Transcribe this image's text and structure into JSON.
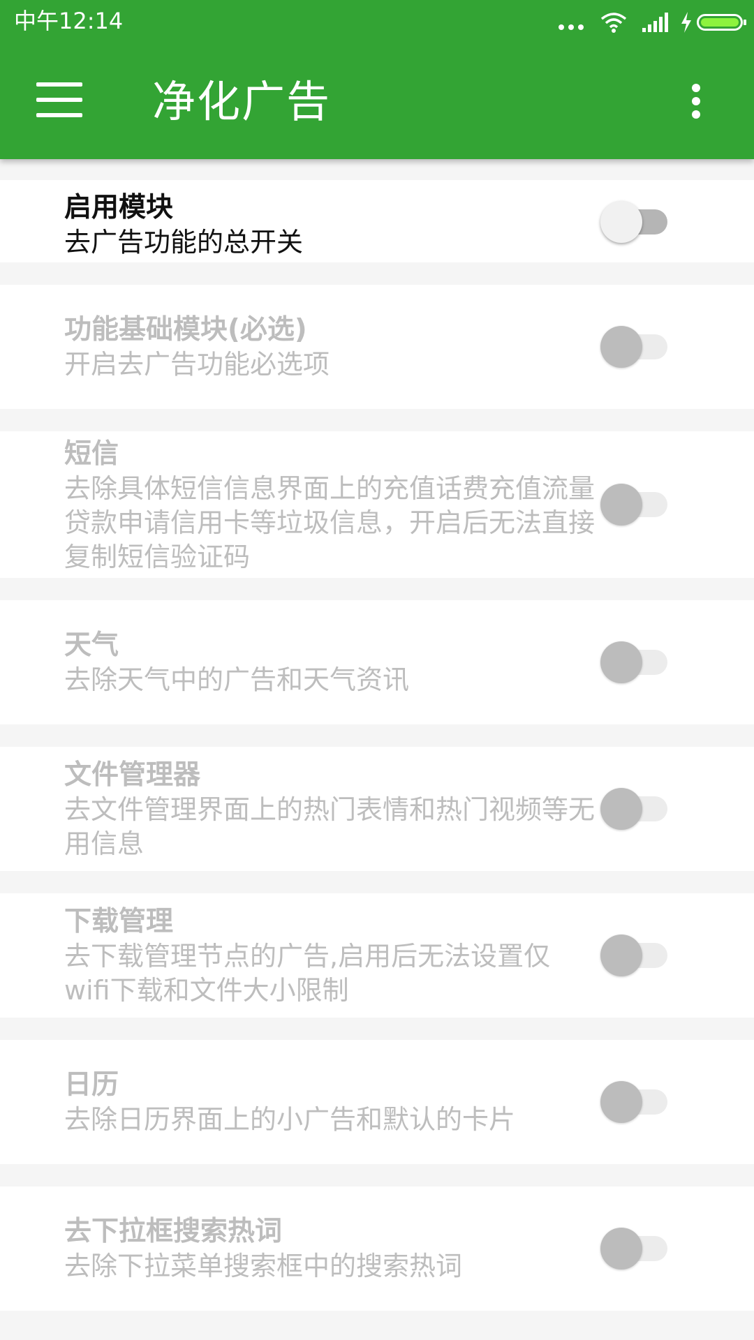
{
  "status_bar": {
    "time": "中午12:14",
    "icons": [
      "more-dots-icon",
      "wifi-icon",
      "signal-icon",
      "charging-bolt-icon",
      "battery-icon"
    ]
  },
  "app_bar": {
    "title": "净化广告",
    "menu_icon": "hamburger-menu-icon",
    "more_icon": "overflow-menu-icon",
    "background_color": "#33a434"
  },
  "settings": [
    {
      "title": "启用模块",
      "description": "去广告功能的总开关",
      "enabled": true,
      "checked": false
    },
    {
      "title": "功能基础模块(必选)",
      "description": "开启去广告功能必选项",
      "enabled": false,
      "checked": false
    },
    {
      "title": "短信",
      "description": "去除具体短信信息界面上的充值话费充值流量贷款申请信用卡等垃圾信息，开启后无法直接复制短信验证码",
      "enabled": false,
      "checked": false
    },
    {
      "title": "天气",
      "description": "去除天气中的广告和天气资讯",
      "enabled": false,
      "checked": false
    },
    {
      "title": "文件管理器",
      "description": "去文件管理界面上的热门表情和热门视频等无用信息",
      "enabled": false,
      "checked": false
    },
    {
      "title": "下载管理",
      "description": "去下载管理节点的广告,启用后无法设置仅wifi下载和文件大小限制",
      "enabled": false,
      "checked": false
    },
    {
      "title": "日历",
      "description": "去除日历界面上的小广告和默认的卡片",
      "enabled": false,
      "checked": false
    },
    {
      "title": "去下拉框搜索热词",
      "description": "去除下拉菜单搜索框中的搜索热词",
      "enabled": false,
      "checked": false
    }
  ]
}
